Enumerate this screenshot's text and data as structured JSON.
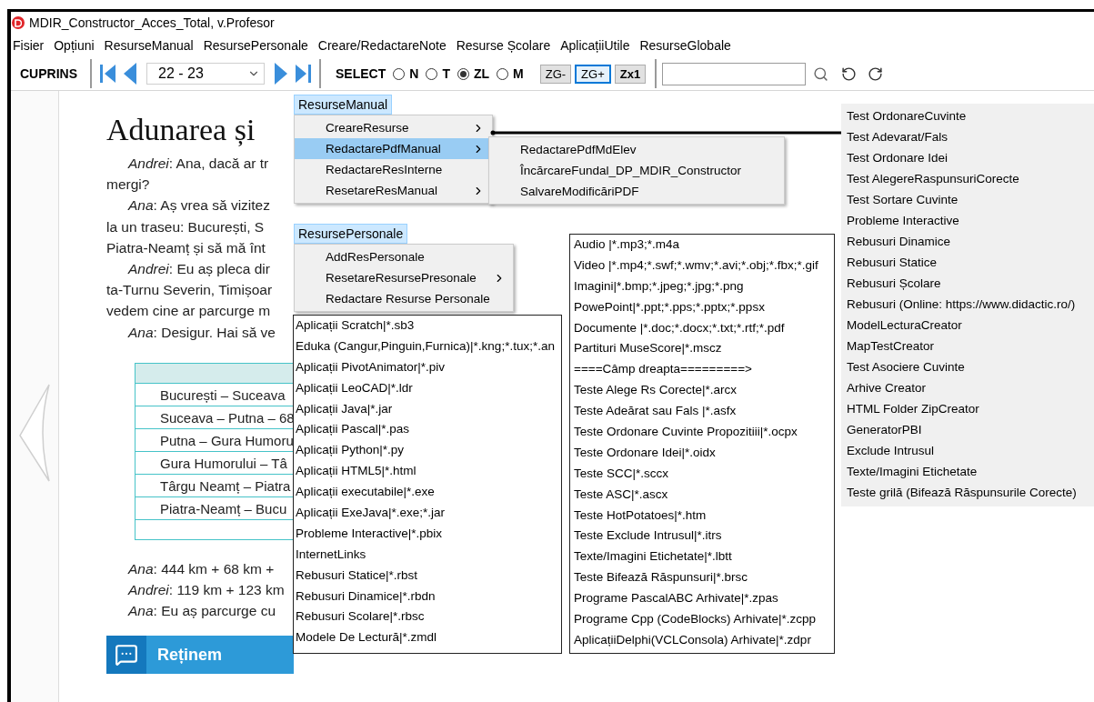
{
  "window": {
    "title": "MDIR_Constructor_Acces_Total, v.Profesor"
  },
  "menu_bar": [
    "Fisier",
    "Opțiuni",
    "ResurseManual",
    "ResursePersonale",
    "Creare/RedactareNote",
    "Resurse Școlare",
    "AplicațiiUtile",
    "ResurseGlobale"
  ],
  "toolbar": {
    "contents_label": "CUPRINS",
    "page_select": {
      "value": "22 - 23"
    },
    "select_label": "SELECT",
    "view_modes": [
      {
        "label": "N",
        "selected": false
      },
      {
        "label": "T",
        "selected": false
      },
      {
        "label": "ZL",
        "selected": true
      },
      {
        "label": "M",
        "selected": false
      }
    ],
    "zoom_buttons": [
      {
        "label": "ZG-",
        "selected": false,
        "emphasized": false
      },
      {
        "label": "ZG+",
        "selected": true,
        "emphasized": false
      },
      {
        "label": "Zx1",
        "selected": false,
        "emphasized": true
      }
    ]
  },
  "page": {
    "title": "Adunarea și",
    "lines": [
      {
        "text": "*Andrei*: Ana, dacă ar tr",
        "indent": true
      },
      {
        "text": "mergi?",
        "indent": false
      },
      {
        "text": "*Ana*: Aș vrea să vizitez",
        "indent": true
      },
      {
        "text": "la un traseu: București, S",
        "indent": false
      },
      {
        "text": "Piatra-Neamț și să mă înt",
        "indent": false
      },
      {
        "text": "*Andrei*: Eu aș pleca dir",
        "indent": true
      },
      {
        "text": "ta-Turnu Severin, Timișoar",
        "indent": false
      },
      {
        "text": "vedem cine ar parcurge m",
        "indent": false
      },
      {
        "text": "*Ana*: Desigur. Hai să ve",
        "indent": true
      }
    ],
    "table_rows": [
      "București – Suceava",
      "Suceava – Putna – 68",
      "Putna – Gura Humoru",
      "Gura Humorului – Tâ",
      "Târgu Neamț – Piatra",
      "Piatra-Neamț – Bucu"
    ],
    "after_lines": [
      "*Ana*: 444 km + 68 km +",
      "*Andrei*: 119 km + 123 km",
      "*Ana*: Eu aș parcurge cu"
    ],
    "banner": "Reținem"
  },
  "resurse_manual_menu": {
    "title": "ResurseManual",
    "items": [
      {
        "label": "CreareResurse",
        "has_submenu": true,
        "selected": false
      },
      {
        "label": "RedactarePdfManual",
        "has_submenu": true,
        "selected": true
      },
      {
        "label": "RedactareResInterne",
        "has_submenu": false,
        "selected": false
      },
      {
        "label": "ResetareResManual",
        "has_submenu": true,
        "selected": false
      }
    ],
    "submenu": [
      "RedactarePdfMdElev",
      "ÎncărcareFundal_DP_MDIR_Constructor",
      "SalvareModificăriPDF"
    ]
  },
  "resurse_personale_menu": {
    "title": "ResursePersonale",
    "items": [
      {
        "label": "AddResPersonale",
        "has_submenu": false,
        "selected": false
      },
      {
        "label": "ResetareResursePresonale",
        "has_submenu": true,
        "selected": false
      },
      {
        "label": "Redactare Resurse Personale",
        "has_submenu": false,
        "selected": false
      }
    ]
  },
  "applications_list": [
    "Aplicații Scratch|*.sb3",
    "Eduka (Cangur,Pinguin,Furnica)|*.kng;*.tux;*.an",
    "Aplicații PivotAnimator|*.piv",
    "Aplicații LeoCAD|*.ldr",
    "Aplicații Java|*.jar",
    "Aplicații Pascal|*.pas",
    "Aplicații Python|*.py",
    "Aplicații HTML5|*.html",
    "Aplicații executabile|*.exe",
    "Aplicații ExeJava|*.exe;*.jar",
    "Probleme Interactive|*.pbix",
    "InternetLinks",
    "Rebusuri Statice|*.rbst",
    "Rebusuri Dinamice|*.rbdn",
    "Rebusuri Scolare|*.rbsc",
    "Modele De Lectură|*.zmdl"
  ],
  "file_types_list": [
    "Audio |*.mp3;*.m4a",
    "Video |*.mp4;*.swf;*.wmv;*.avi;*.obj;*.fbx;*.gif",
    "Imagini|*.bmp;*.jpeg;*.jpg;*.png",
    "PowePoint|*.ppt;*.pps;*.pptx;*.ppsx",
    "Documente  |*.doc;*.docx;*.txt;*.rtf;*.pdf",
    "Partituri MuseScore|*.mscz",
    "====Câmp dreapta=========>",
    "Teste Alege Rs Corecte|*.arcx",
    "Teste Adeărat sau Fals |*.asfx",
    "Teste Ordonare Cuvinte Propozitiii|*.ocpx",
    "Teste Ordonare Idei|*.oidx",
    "Teste SCC|*.sccx",
    "Teste ASC|*.ascx",
    "Teste HotPotatoes|*.htm",
    "Teste Exclude Intrusul|*.itrs",
    "Texte/Imagini Etichetate|*.lbtt",
    "Teste Bifează Răspunsuri|*.brsc",
    "Programe PascalABC Arhivate|*.zpas",
    "Programe Cpp (CodeBlocks) Arhivate|*.zcpp",
    "AplicațiiDelphi(VCLConsola) Arhivate|*.zdpr"
  ],
  "creators_list": [
    "Test OrdonareCuvinte",
    "Test Adevarat/Fals",
    "Test Ordonare Idei",
    "Test AlegereRaspunsuriCorecte",
    "Test Sortare Cuvinte",
    "Probleme Interactive",
    "Rebusuri Dinamice",
    "Rebusuri Statice",
    "Rebusuri Școlare",
    "Rebusuri (Online: https://www.didactic.ro/)",
    "ModelLecturaCreator",
    "MapTestCreator",
    "Test Asociere Cuvinte",
    "Arhive Creator",
    "HTML Folder ZipCreator",
    "GeneratorPBI",
    "Exclude Intrusul",
    "Texte/Imagini Etichetate",
    "Teste grilă (Bifează Răspunsurile Corecte)"
  ]
}
